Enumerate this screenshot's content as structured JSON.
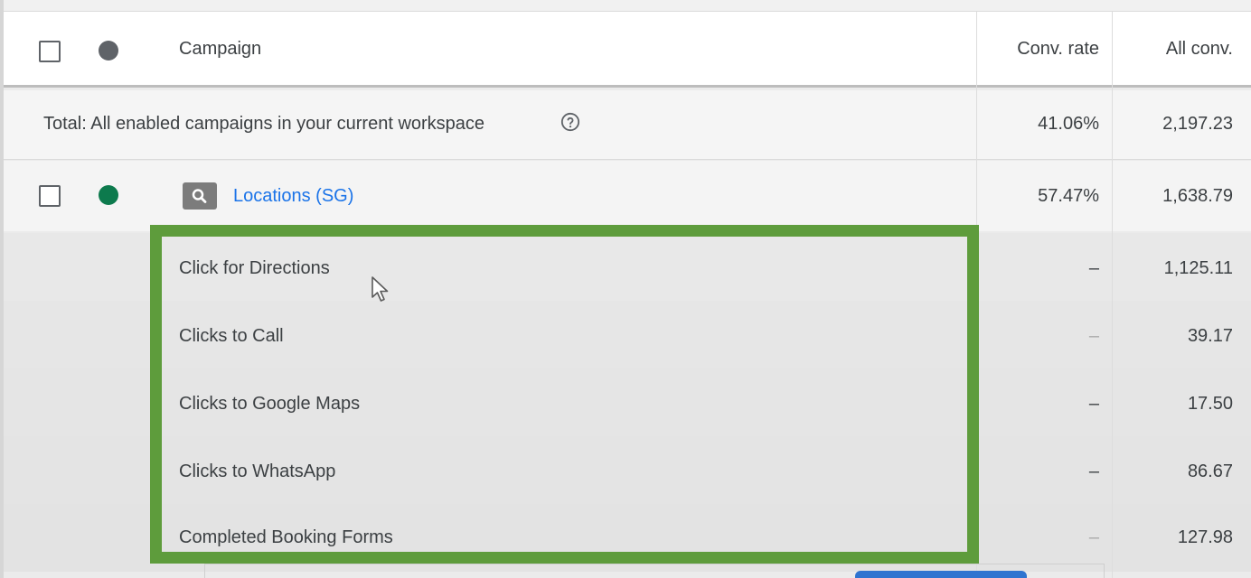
{
  "header": {
    "campaign_label": "Campaign",
    "conv_rate_label": "Conv. rate",
    "all_conv_label": "All conv."
  },
  "total": {
    "label": "Total: All enabled campaigns in your current workspace",
    "conv_rate": "41.06%",
    "all_conv": "2,197.23"
  },
  "campaign": {
    "name": "Locations (SG)",
    "conv_rate": "57.47%",
    "all_conv": "1,638.79",
    "status_color": "#0d7a4d"
  },
  "conversion_actions": [
    {
      "name": "Click for Directions",
      "conv_rate": "–",
      "all_conv": "1,125.11"
    },
    {
      "name": "Clicks to Call",
      "conv_rate": "–",
      "all_conv": "39.17"
    },
    {
      "name": "Clicks to Google Maps",
      "conv_rate": "–",
      "all_conv": "17.50"
    },
    {
      "name": "Clicks to WhatsApp",
      "conv_rate": "–",
      "all_conv": "86.67"
    },
    {
      "name": "Completed Booking Forms",
      "conv_rate": "–",
      "all_conv": "127.98"
    }
  ],
  "colors": {
    "link": "#1a73e8",
    "highlight": "#5e9c3c",
    "header_dot": "#5f6368"
  },
  "icons": {
    "help": "help-circle-icon",
    "search": "search-icon",
    "cursor": "mouse-pointer-icon"
  }
}
